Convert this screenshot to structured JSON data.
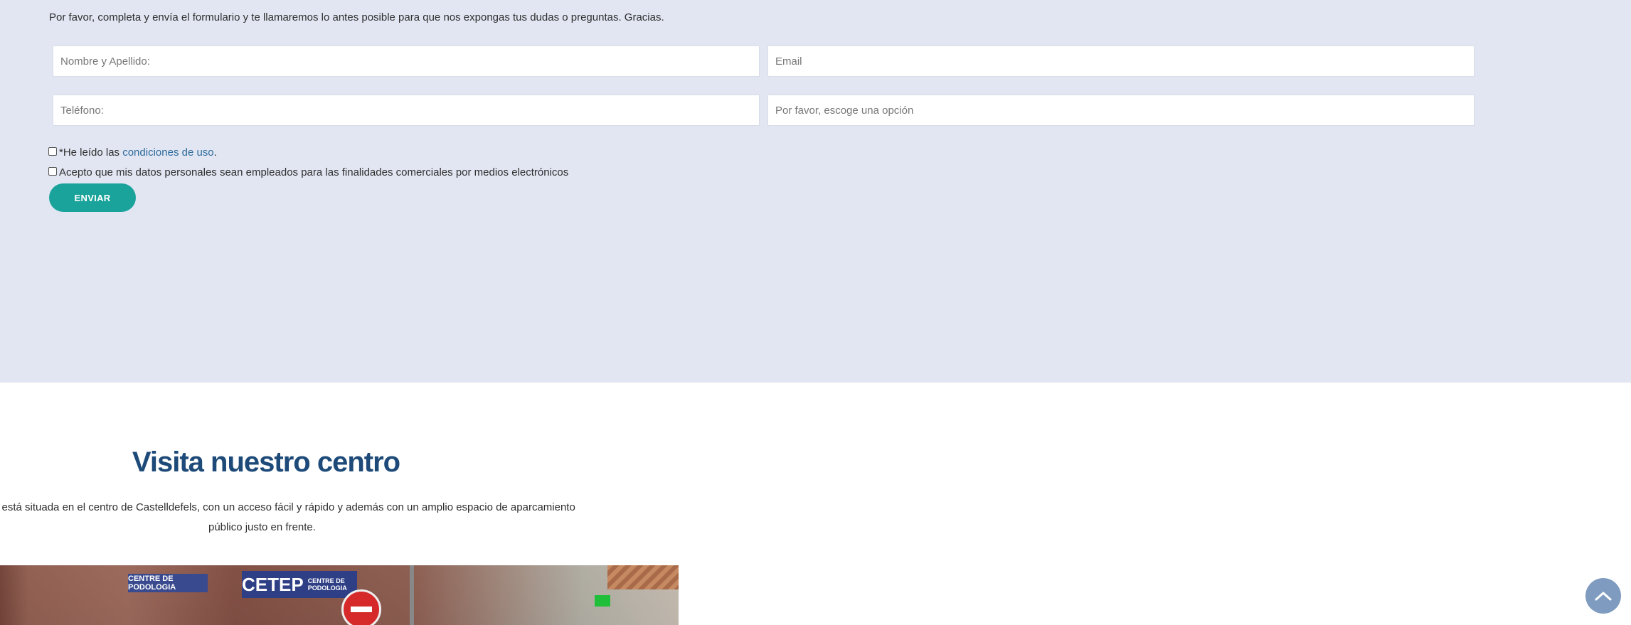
{
  "form": {
    "intro": "Por favor, completa y envía el formulario y te llamaremos lo antes posible para que nos expongas tus dudas o preguntas. Gracias.",
    "name_placeholder": "Nombre y Apellido:",
    "email_placeholder": "Email",
    "phone_placeholder": "Teléfono:",
    "option_placeholder": "Por favor, escoge una opción",
    "terms_prefix": "*He leído las ",
    "terms_link": "condiciones de uso",
    "terms_suffix": ".",
    "consent_label": "Acepto que mis datos personales sean empleados para las finalidades comerciales por medios electrónicos",
    "submit_label": "ENVIAR"
  },
  "visit": {
    "title": "Visita nuestro centro",
    "text_line1": "a está situada en el centro de Castelldefels, con un acceso fácil y rápido y además con un amplio espacio de aparcamiento",
    "text_line2": "público justo en frente."
  },
  "photo": {
    "sign_left": "CENTRE DE PODOLOGIA",
    "sign_main": "CETEP",
    "sign_sub": "CENTRE DE PODOLOGIA"
  },
  "colors": {
    "form_background": "#e1e6f2",
    "accent_button": "#1aa39b",
    "title_color": "#1d4a78",
    "link_color": "#2f6b9c",
    "scroll_top_button": "#7f9cc0"
  },
  "icons": {
    "scroll_top": "chevron-up-icon"
  }
}
